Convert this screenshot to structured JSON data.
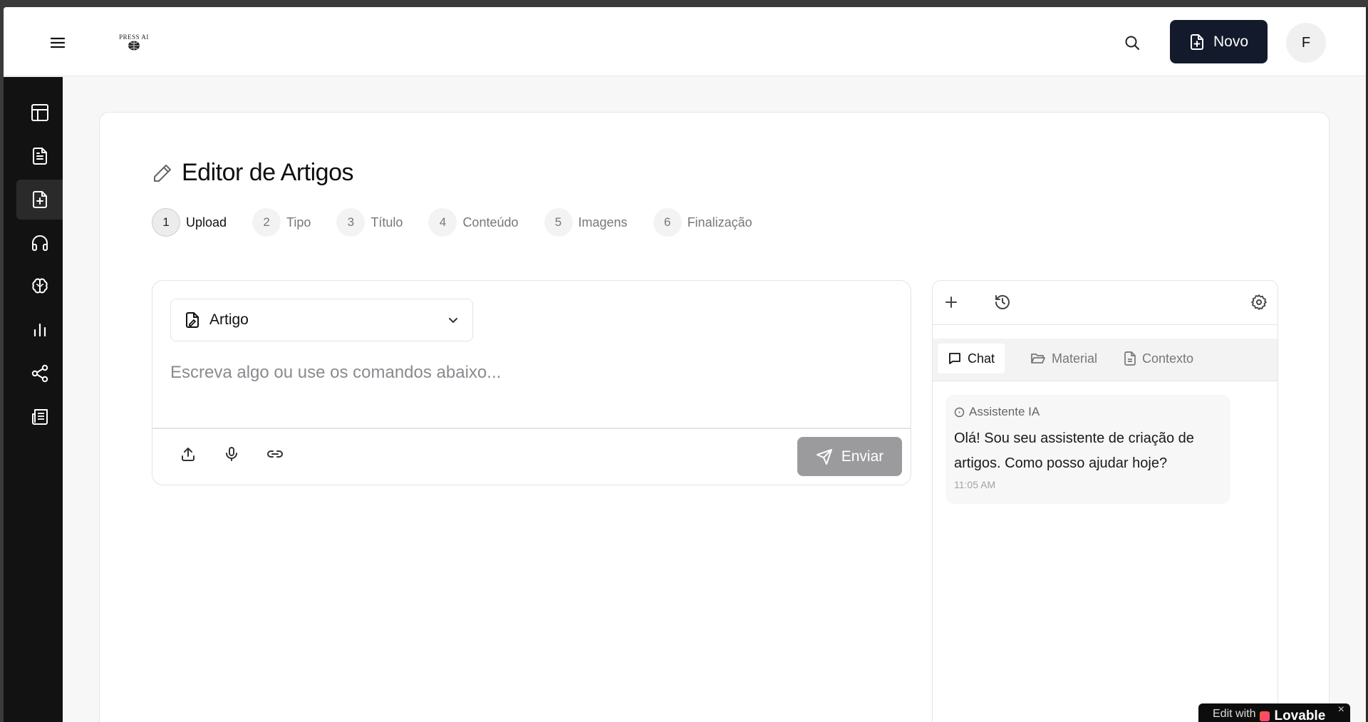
{
  "header": {
    "logo_text": "PRESS AI",
    "new_button_label": "Novo",
    "avatar_initial": "F"
  },
  "sidebar": {
    "items": [
      {
        "icon": "layout-icon",
        "active": false
      },
      {
        "icon": "file-text-icon",
        "active": false
      },
      {
        "icon": "file-plus-icon",
        "active": true
      },
      {
        "icon": "headphones-icon",
        "active": false
      },
      {
        "icon": "brain-icon",
        "active": false
      },
      {
        "icon": "bar-chart-icon",
        "active": false
      },
      {
        "icon": "share-icon",
        "active": false
      },
      {
        "icon": "newspaper-icon",
        "active": false
      }
    ]
  },
  "page": {
    "title": "Editor de Artigos"
  },
  "steps": [
    {
      "num": "1",
      "label": "Upload",
      "active": true
    },
    {
      "num": "2",
      "label": "Tipo",
      "active": false
    },
    {
      "num": "3",
      "label": "Título",
      "active": false
    },
    {
      "num": "4",
      "label": "Conteúdo",
      "active": false
    },
    {
      "num": "5",
      "label": "Imagens",
      "active": false
    },
    {
      "num": "6",
      "label": "Finalização",
      "active": false
    }
  ],
  "composer": {
    "type_selected": "Artigo",
    "placeholder": "Escreva algo ou use os comandos abaixo...",
    "send_label": "Enviar"
  },
  "assistant": {
    "tabs": [
      {
        "label": "Chat",
        "icon": "message-square-icon",
        "active": true
      },
      {
        "label": "Material",
        "icon": "folder-open-icon",
        "active": false
      },
      {
        "label": "Contexto",
        "icon": "file-icon",
        "active": false
      }
    ],
    "message": {
      "sender": "Assistente IA",
      "text": "Olá! Sou seu assistente de criação de artigos. Como posso ajudar hoje?",
      "time": "11:05 AM"
    }
  },
  "badge": {
    "edit_label": "Edit with",
    "brand": "Lovable",
    "close": "×"
  },
  "colors": {
    "primary": "#131a2b",
    "sidebar_bg": "#121212",
    "send_disabled": "#9b9b9d"
  }
}
